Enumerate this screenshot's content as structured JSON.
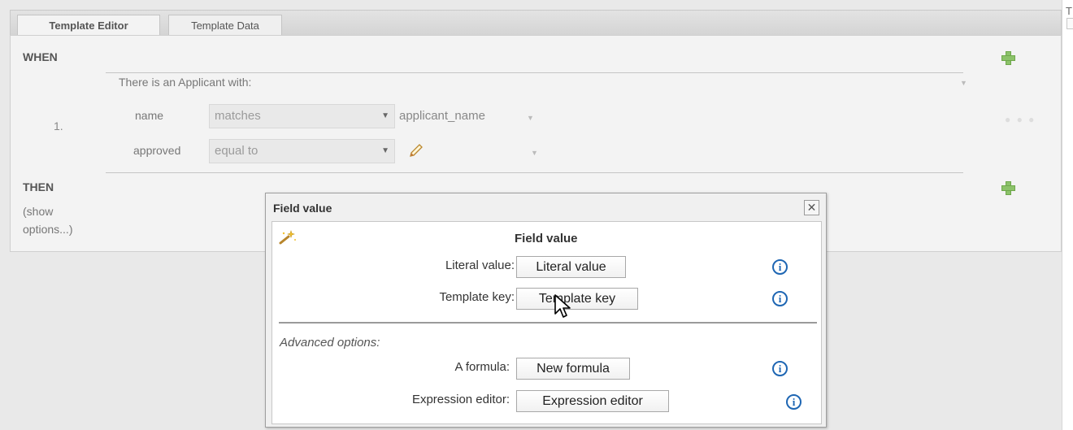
{
  "tabs": [
    {
      "label": "Template Editor",
      "active": true
    },
    {
      "label": "Template Data",
      "active": false
    }
  ],
  "right_strip": {
    "letter": "T"
  },
  "rule": {
    "when_label": "WHEN",
    "then_label": "THEN",
    "show_options": "(show options...)",
    "pattern_title": "There is an Applicant with:",
    "row_number": "1.",
    "constraints": [
      {
        "field": "name",
        "operator": "matches",
        "value": "applicant_name"
      },
      {
        "field": "approved",
        "operator": "equal to",
        "value": ""
      }
    ]
  },
  "dialog": {
    "title": "Field value",
    "close_glyph": "✕",
    "heading": "Field value",
    "options": [
      {
        "label": "Literal value:",
        "button": "Literal value"
      },
      {
        "label": "Template key:",
        "button": "Template key"
      }
    ],
    "advanced_label": "Advanced options:",
    "advanced_options": [
      {
        "label": "A formula:",
        "button": "New formula"
      },
      {
        "label": "Expression editor:",
        "button": "Expression editor"
      }
    ],
    "info_glyph": "i"
  },
  "icons": {
    "add": "plus-icon",
    "edit": "pencil-icon",
    "info": "info-icon",
    "wizard": "wand-icon",
    "dropdown": "chevron-down-icon"
  },
  "colors": {
    "add_icon": "#8cc26a",
    "info_icon": "#1e66b3",
    "panel_bg": "#f3f3f3"
  }
}
